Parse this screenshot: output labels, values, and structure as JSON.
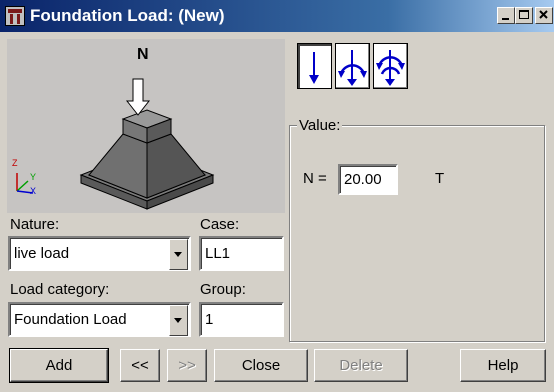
{
  "window": {
    "title": "Foundation Load: (New)",
    "controls": [
      "minimize-icon",
      "maximize-icon",
      "close-icon"
    ]
  },
  "preview": {
    "load_label": "N",
    "axes": {
      "z": "Z",
      "y": "Y",
      "x": "X"
    }
  },
  "load_types": [
    {
      "name": "vertical-force-icon",
      "selected": true
    },
    {
      "name": "moment-icon",
      "selected": false
    },
    {
      "name": "force-moment-icon",
      "selected": false
    }
  ],
  "form": {
    "nature_label": "Nature:",
    "nature_value": "live load",
    "case_label": "Case:",
    "case_value": "LL1",
    "load_category_label": "Load category:",
    "load_category_value": "Foundation Load",
    "group_label": "Group:",
    "group_value": "1"
  },
  "value_group": {
    "title": "Value:",
    "n_label": "N =",
    "n_value": "20.00",
    "unit": "T"
  },
  "buttons": {
    "add": "Add",
    "prev": "<<",
    "next": ">>",
    "close": "Close",
    "delete": "Delete",
    "help": "Help"
  },
  "colors": {
    "title_start": "#0a246a",
    "title_end": "#a6caf0",
    "icon_blue": "#0000c8",
    "dialog_bg": "#d4d0c8"
  }
}
